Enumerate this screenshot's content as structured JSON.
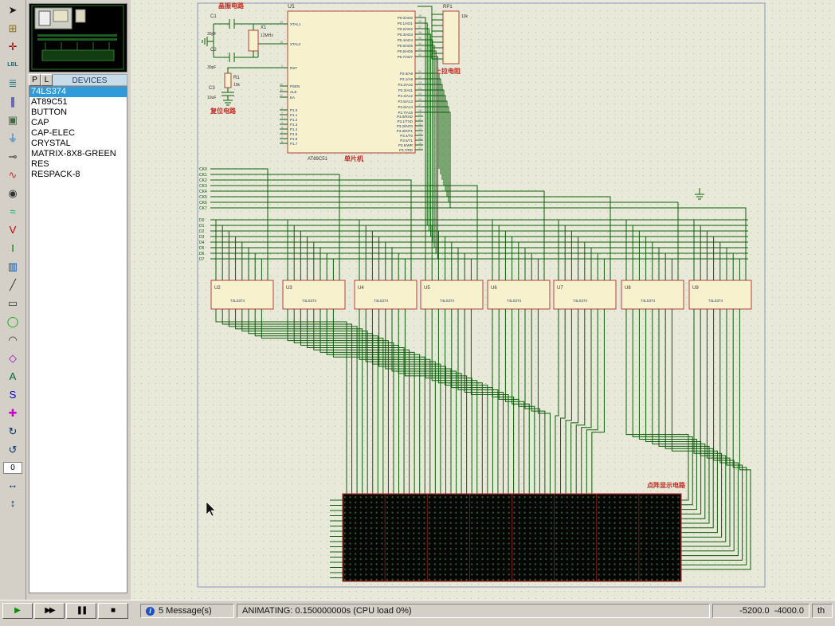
{
  "toolbar": {
    "icons": [
      {
        "name": "selection-mode-icon",
        "glyph": "➤",
        "color": "#1a1a1a"
      },
      {
        "name": "component-mode-icon",
        "glyph": "⊞",
        "color": "#8a6d1a"
      },
      {
        "name": "junction-dot-icon",
        "glyph": "✛",
        "color": "#a00000"
      },
      {
        "name": "wire-label-icon",
        "glyph": "LBL",
        "color": "#267",
        "small": true
      },
      {
        "name": "text-script-icon",
        "glyph": "≣",
        "color": "#267a8a"
      },
      {
        "name": "bus-mode-icon",
        "glyph": "∥",
        "color": "#0000aa"
      },
      {
        "name": "subcircuit-icon",
        "glyph": "▣",
        "color": "#446644"
      },
      {
        "name": "terminal-mode-icon",
        "glyph": "⏚",
        "color": "#0066cc"
      },
      {
        "name": "device-pin-icon",
        "glyph": "⊸",
        "color": "#333333"
      },
      {
        "name": "graph-mode-icon",
        "glyph": "∿",
        "color": "#bb3333"
      },
      {
        "name": "tape-recorder-icon",
        "glyph": "◉",
        "color": "#333333"
      },
      {
        "name": "generator-mode-icon",
        "glyph": "≈",
        "color": "#00aa77"
      },
      {
        "name": "voltage-probe-icon",
        "glyph": "V",
        "color": "#cc0000"
      },
      {
        "name": "current-probe-icon",
        "glyph": "I",
        "color": "#007700"
      },
      {
        "name": "virtual-instruments-icon",
        "glyph": "▥",
        "color": "#0055aa"
      },
      {
        "name": "line-2d-icon",
        "glyph": "╱",
        "color": "#333333"
      },
      {
        "name": "box-2d-icon",
        "glyph": "▭",
        "color": "#333333"
      },
      {
        "name": "circle-2d-icon",
        "glyph": "◯",
        "color": "#00aa00"
      },
      {
        "name": "arc-2d-icon",
        "glyph": "◠",
        "color": "#333333"
      },
      {
        "name": "path-2d-icon",
        "glyph": "◇",
        "color": "#9900cc"
      },
      {
        "name": "text-2d-icon",
        "glyph": "A",
        "color": "#006633"
      },
      {
        "name": "symbol-2d-icon",
        "glyph": "S",
        "color": "#0000cc"
      },
      {
        "name": "marker-2d-icon",
        "glyph": "✚",
        "color": "#cc00cc"
      },
      {
        "name": "rotate-cw-icon",
        "glyph": "↻",
        "color": "#003366"
      },
      {
        "name": "rotate-ccw-icon",
        "glyph": "↺",
        "color": "#003366"
      },
      {
        "name": "rotation-angle-input",
        "input": true
      },
      {
        "name": "mirror-horizontal-icon",
        "glyph": "↔",
        "color": "#003366"
      },
      {
        "name": "mirror-vertical-icon",
        "glyph": "↕",
        "color": "#003366"
      }
    ],
    "rotation_value": "0"
  },
  "panel": {
    "p_button": "P",
    "l_button": "L",
    "header": "DEVICES",
    "devices": [
      "74LS374",
      "AT89C51",
      "BUTTON",
      "CAP",
      "CAP-ELEC",
      "CRYSTAL",
      "MATRIX-8X8-GREEN",
      "RES",
      "RESPACK-8"
    ],
    "selected_index": 0
  },
  "schematic": {
    "annotations": {
      "crystal_label": "晶振电路",
      "reset_label": "复位电路",
      "mcu_label": "单片机",
      "pullup_label": "上拉电阻",
      "matrix_label": "点阵显示电路"
    },
    "components": {
      "u1": {
        "ref": "U1",
        "value": "AT89C51"
      },
      "c1": {
        "ref": "C1",
        "value": "30pF"
      },
      "c2": {
        "ref": "C2",
        "value": "30pF"
      },
      "x1": {
        "ref": "X1",
        "value": "12MHz"
      },
      "r1": {
        "ref": "R1",
        "value": "10k"
      },
      "c3": {
        "ref": "C3",
        "value": "10uF"
      },
      "rp1": {
        "ref": "RP1",
        "value": "10k"
      },
      "latches": [
        {
          "ref": "U2",
          "value": "74LS374"
        },
        {
          "ref": "U3",
          "value": "74LS374"
        },
        {
          "ref": "U4",
          "value": "74LS374"
        },
        {
          "ref": "U5",
          "value": "74LS374"
        },
        {
          "ref": "U6",
          "value": "74LS374"
        },
        {
          "ref": "U7",
          "value": "74LS374"
        },
        {
          "ref": "U8",
          "value": "74LS374"
        },
        {
          "ref": "U9",
          "value": "74LS374"
        }
      ]
    },
    "nets": {
      "clock": [
        "CK0",
        "CK1",
        "CK2",
        "CK3",
        "CK4",
        "CK5",
        "CK6",
        "CK7"
      ],
      "data": [
        "D0",
        "D1",
        "D2",
        "D3",
        "D4",
        "D5",
        "D6",
        "D7"
      ]
    },
    "u1_left": [
      {
        "num": "19",
        "label": "XTAL1"
      },
      {
        "num": "18",
        "label": "XTAL2"
      },
      {
        "num": "9",
        "label": "RST"
      },
      {
        "num": "29",
        "label": "PSEN"
      },
      {
        "num": "30",
        "label": "ALE"
      },
      {
        "num": "31",
        "label": "EA"
      },
      {
        "num": "1",
        "label": "P1.0"
      },
      {
        "num": "2",
        "label": "P1.1"
      },
      {
        "num": "3",
        "label": "P1.2"
      },
      {
        "num": "4",
        "label": "P1.3"
      },
      {
        "num": "5",
        "label": "P1.4"
      },
      {
        "num": "6",
        "label": "P1.5"
      },
      {
        "num": "7",
        "label": "P1.6"
      },
      {
        "num": "8",
        "label": "P1.7"
      }
    ],
    "u1_right": [
      {
        "num": "39",
        "label": "P0.0/AD0"
      },
      {
        "num": "38",
        "label": "P0.1/AD1"
      },
      {
        "num": "37",
        "label": "P0.2/AD2"
      },
      {
        "num": "36",
        "label": "P0.3/AD3"
      },
      {
        "num": "35",
        "label": "P0.4/AD4"
      },
      {
        "num": "34",
        "label": "P0.5/AD5"
      },
      {
        "num": "33",
        "label": "P0.6/AD6"
      },
      {
        "num": "32",
        "label": "P0.7/AD7"
      },
      {
        "num": "21",
        "label": "P2.0/A8"
      },
      {
        "num": "22",
        "label": "P2.1/A9"
      },
      {
        "num": "23",
        "label": "P2.2/A10"
      },
      {
        "num": "24",
        "label": "P2.3/A11"
      },
      {
        "num": "25",
        "label": "P2.4/A12"
      },
      {
        "num": "26",
        "label": "P2.5/A13"
      },
      {
        "num": "27",
        "label": "P2.6/A14"
      },
      {
        "num": "28",
        "label": "P2.7/A15"
      },
      {
        "num": "10",
        "label": "P3.0/RXD"
      },
      {
        "num": "11",
        "label": "P3.1/TXD"
      },
      {
        "num": "12",
        "label": "P3.2/INT0"
      },
      {
        "num": "13",
        "label": "P3.3/INT1"
      },
      {
        "num": "14",
        "label": "P3.4/T0"
      },
      {
        "num": "15",
        "label": "P3.5/T1"
      },
      {
        "num": "16",
        "label": "P3.6/WR"
      },
      {
        "num": "17",
        "label": "P3.7/RD"
      }
    ]
  },
  "statusbar": {
    "controls": [
      {
        "name": "play-button",
        "glyph": "▶",
        "green": true
      },
      {
        "name": "step-button",
        "glyph": "▶▶"
      },
      {
        "name": "pause-button",
        "glyph": "❚❚"
      },
      {
        "name": "stop-button",
        "glyph": "■"
      }
    ],
    "messages": "5 Message(s)",
    "animating": "ANIMATING: 0.150000000s (CPU load 0%)",
    "coord_x": "-5200.0",
    "coord_y": "-4000.0",
    "coord_unit": "th"
  }
}
